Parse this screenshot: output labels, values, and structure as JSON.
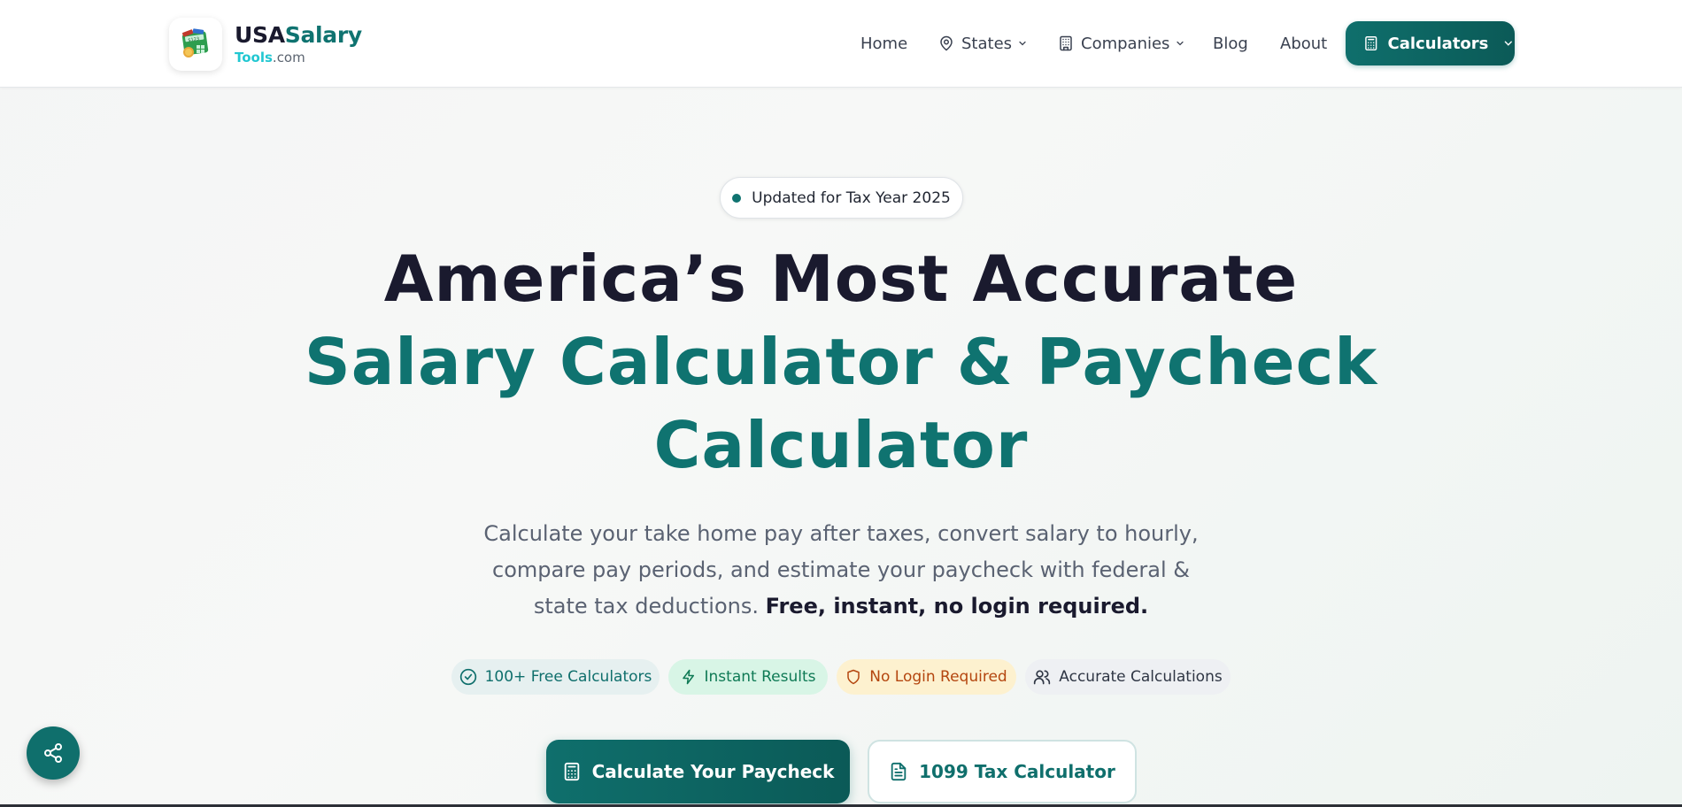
{
  "brand": {
    "name_part1": "USA",
    "name_part2": "Salary",
    "sub_part1": "Tools",
    "sub_part2": ".com",
    "logo_icon": "money-calculator-icon"
  },
  "nav": {
    "items": [
      {
        "label": "Home",
        "icon": null,
        "dropdown": false
      },
      {
        "label": "States",
        "icon": "map-pin-icon",
        "dropdown": true
      },
      {
        "label": "Companies",
        "icon": "building-icon",
        "dropdown": true
      },
      {
        "label": "Blog",
        "icon": null,
        "dropdown": false
      },
      {
        "label": "About",
        "icon": null,
        "dropdown": false
      }
    ],
    "cta_label": "Calculators",
    "cta_icon": "calculator-icon"
  },
  "hero": {
    "badge": "Updated for Tax Year 2025",
    "headline_line1": "America’s Most Accurate",
    "headline_line2": "Salary Calculator & Paycheck",
    "headline_line3": "Calculator",
    "subtext": "Calculate your take home pay after taxes, convert salary to hourly, compare pay periods, and estimate your paycheck with federal & state tax deductions.",
    "subtext_bold": "Free, instant, no login required."
  },
  "features": [
    {
      "label": "100+ Free Calculators",
      "icon": "check-circle-icon"
    },
    {
      "label": "Instant Results",
      "icon": "lightning-icon"
    },
    {
      "label": "No Login Required",
      "icon": "shield-icon"
    },
    {
      "label": "Accurate Calculations",
      "icon": "users-icon"
    }
  ],
  "buttons": {
    "primary_label": "Calculate Your Paycheck",
    "secondary_label": "1099 Tax Calculator"
  },
  "share_icon": "share-icon",
  "colors": {
    "primary": "#0f7370",
    "dark": "#1a1a2e",
    "accent": "#22c7d1"
  }
}
